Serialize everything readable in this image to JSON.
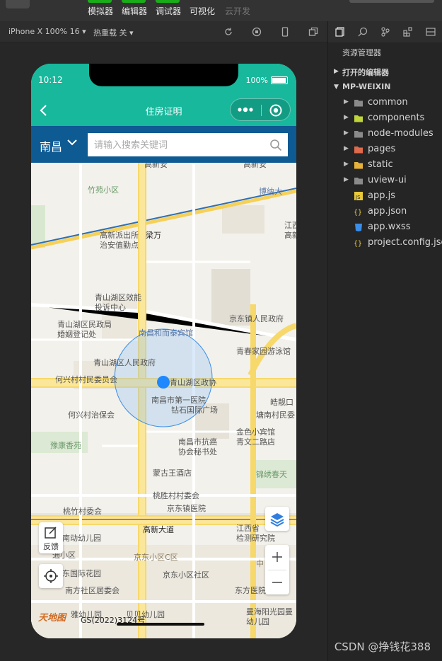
{
  "topbar": {
    "items": [
      "模拟器",
      "编辑器",
      "调试器",
      "可视化",
      "云开发"
    ]
  },
  "toolbar": {
    "device": "iPhone X 100% 16 ▾",
    "hotreload": "热重载 关 ▾"
  },
  "phone": {
    "time": "10:12",
    "battery": "100%",
    "title": "住房证明",
    "city": "南昌",
    "search_placeholder": "请输入搜索关键词"
  },
  "map": {
    "labels": [
      "竹苑小区",
      "博纳大",
      "高新派出所",
      "治安值勤点",
      "梁万",
      "江西",
      "高新",
      "青山湖区效能",
      "投诉中心",
      "青山湖区民政局",
      "婚姻登记处",
      "南昌和而泰宾馆",
      "京东镇人民政府",
      "青春家园游泳馆",
      "青山湖区人民政府",
      "何兴村村民委员会",
      "青山湖区政协",
      "皓靓口",
      "南昌市第一医院",
      "钻石国际广场",
      "塘南村民委",
      "何兴村治保会",
      "豫康香苑",
      "金色小宾馆",
      "青文二路店",
      "南昌市抗癌",
      "协会秘书处",
      "锦绣春天",
      "蒙古王酒店",
      "桃胜村村委会",
      "桃竹村委会",
      "京东镇医院",
      "高新大道",
      "江西省",
      "检测研究院",
      "南动幼儿园",
      "通小区",
      "京东小区C区",
      "东国际花园",
      "京东小区社区",
      "南方社区居委会",
      "东方医院",
      "雅幼儿园",
      "贝贝幼儿园",
      "曼海阳光园曼",
      "幼儿园",
      "GS(2022)3124号",
      "高新安",
      "中"
    ],
    "feedback": "反馈",
    "logo_text": "天地图"
  },
  "sidebar": {
    "title": "资源管理器",
    "sections": [
      "打开的编辑器",
      "MP-WEIXIN"
    ],
    "files": [
      {
        "name": "common",
        "type": "folder",
        "color": "#8a8a8a"
      },
      {
        "name": "components",
        "type": "folder",
        "color": "#c0d53b"
      },
      {
        "name": "node-modules",
        "type": "folder",
        "color": "#8a8a8a"
      },
      {
        "name": "pages",
        "type": "folder",
        "color": "#e06a4b"
      },
      {
        "name": "static",
        "type": "folder",
        "color": "#e8b23a"
      },
      {
        "name": "uview-ui",
        "type": "folder",
        "color": "#8a8a8a"
      },
      {
        "name": "app.js",
        "type": "js",
        "color": "#e8c93a"
      },
      {
        "name": "app.json",
        "type": "json",
        "color": "#e8c93a"
      },
      {
        "name": "app.wxss",
        "type": "css",
        "color": "#3a8ee8"
      },
      {
        "name": "project.config.json",
        "type": "json",
        "color": "#e8c93a"
      }
    ]
  },
  "watermark": "CSDN @挣钱花388",
  "colors": {
    "accent": "#17b89c",
    "searchbar": "#0e5a93",
    "location": "#1e88ff"
  }
}
